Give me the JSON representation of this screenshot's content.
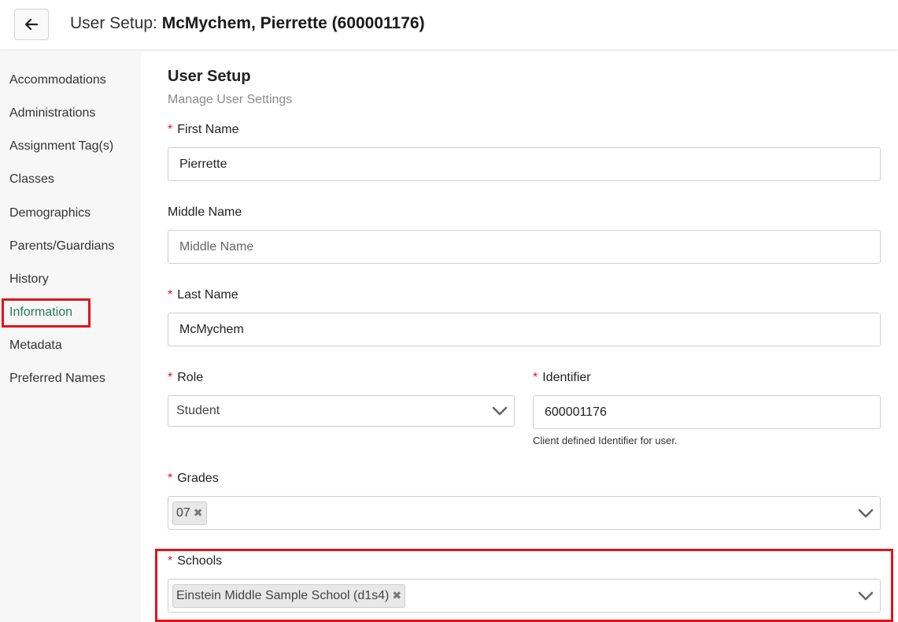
{
  "header": {
    "title_prefix": "User Setup: ",
    "title_name": "McMychem, Pierrette (600001176)"
  },
  "sidebar": {
    "items": [
      {
        "label": "Accommodations"
      },
      {
        "label": "Administrations"
      },
      {
        "label": "Assignment Tag(s)"
      },
      {
        "label": "Classes"
      },
      {
        "label": "Demographics"
      },
      {
        "label": "Parents/Guardians"
      },
      {
        "label": "History"
      },
      {
        "label": "Information"
      },
      {
        "label": "Metadata"
      },
      {
        "label": "Preferred Names"
      }
    ],
    "active": "Information"
  },
  "main": {
    "title": "User Setup",
    "subtitle": "Manage User Settings",
    "required_mark": "*",
    "first_name": {
      "label": "First Name",
      "value": "Pierrette"
    },
    "middle_name": {
      "label": "Middle Name",
      "value": "",
      "placeholder": "Middle Name"
    },
    "last_name": {
      "label": "Last Name",
      "value": "McMychem"
    },
    "role": {
      "label": "Role",
      "value": "Student"
    },
    "identifier": {
      "label": "Identifier",
      "value": "600001176",
      "help": "Client defined Identifier for user."
    },
    "grades": {
      "label": "Grades",
      "tags": [
        "07"
      ]
    },
    "schools": {
      "label": "Schools",
      "tags": [
        "Einstein Middle Sample School (d1s4)"
      ]
    }
  },
  "colors": {
    "accent": "#237a5b",
    "required": "#e0141b",
    "highlight": "#e0141b"
  }
}
